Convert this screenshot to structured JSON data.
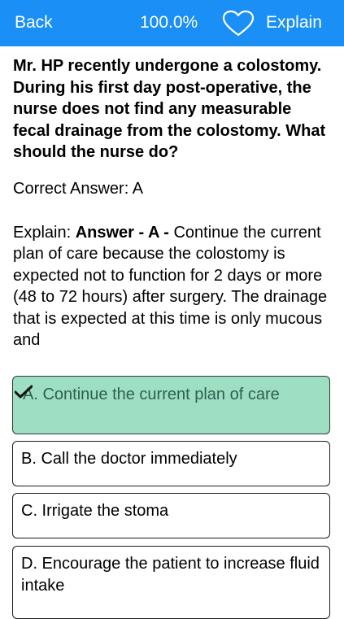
{
  "navbar": {
    "back_label": "Back",
    "progress": "100.0%",
    "heart_icon": "heart-outline-icon",
    "explain_label": "Explain",
    "bg_color": "#1a8ff5"
  },
  "question": {
    "text": "Mr. HP recently undergone a colostomy. During his first day post-operative, the nurse does not find any measurable fecal drainage from the colostomy. What should the nurse do?"
  },
  "answer": {
    "correct_line": "Correct Answer: A",
    "explain_prefix": "Explain: ",
    "explain_bold": "Answer - A -",
    "explain_text": " Continue the current plan of care because the colostomy is expected not to function for 2 days or more (48 to 72 hours) after surgery. The drainage that is expected at this time is only mucous and"
  },
  "options": [
    {
      "label": "A. Continue the current plan of care",
      "correct": true,
      "color": "#9edfc4"
    },
    {
      "label": "B. Call the doctor immediately",
      "correct": false
    },
    {
      "label": "C. Irrigate the stoma",
      "correct": false
    },
    {
      "label": "D. Encourage the patient to increase fluid intake",
      "correct": false
    }
  ]
}
